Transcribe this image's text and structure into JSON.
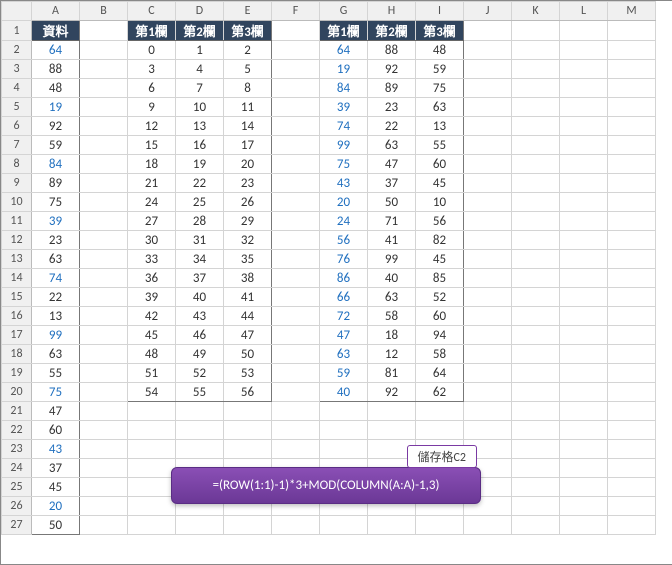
{
  "columns": [
    "A",
    "B",
    "C",
    "D",
    "E",
    "F",
    "G",
    "H",
    "I",
    "J",
    "K",
    "L",
    "M"
  ],
  "row_count": 27,
  "headers": {
    "A1": "資料",
    "C1": "第1欄",
    "D1": "第2欄",
    "E1": "第3欄",
    "G1": "第1欄",
    "H1": "第2欄",
    "I1": "第3欄"
  },
  "colA": {
    "values": [
      64,
      88,
      48,
      19,
      92,
      59,
      84,
      89,
      75,
      39,
      23,
      63,
      74,
      22,
      13,
      99,
      63,
      55,
      75,
      47,
      60,
      43,
      37,
      45,
      20,
      50
    ],
    "highlight": [
      true,
      false,
      false,
      true,
      false,
      false,
      true,
      false,
      false,
      true,
      false,
      false,
      true,
      false,
      false,
      true,
      false,
      false,
      true,
      false,
      false,
      true,
      false,
      false,
      true,
      false
    ]
  },
  "blockCDE": {
    "rows": 19,
    "data": [
      [
        0,
        1,
        2
      ],
      [
        3,
        4,
        5
      ],
      [
        6,
        7,
        8
      ],
      [
        9,
        10,
        11
      ],
      [
        12,
        13,
        14
      ],
      [
        15,
        16,
        17
      ],
      [
        18,
        19,
        20
      ],
      [
        21,
        22,
        23
      ],
      [
        24,
        25,
        26
      ],
      [
        27,
        28,
        29
      ],
      [
        30,
        31,
        32
      ],
      [
        33,
        34,
        35
      ],
      [
        36,
        37,
        38
      ],
      [
        39,
        40,
        41
      ],
      [
        42,
        43,
        44
      ],
      [
        45,
        46,
        47
      ],
      [
        48,
        49,
        50
      ],
      [
        51,
        52,
        53
      ],
      [
        54,
        55,
        56
      ]
    ]
  },
  "blockGHI": {
    "rows": 19,
    "data": [
      [
        64,
        88,
        48
      ],
      [
        19,
        92,
        59
      ],
      [
        84,
        89,
        75
      ],
      [
        39,
        23,
        63
      ],
      [
        74,
        22,
        13
      ],
      [
        99,
        63,
        55
      ],
      [
        75,
        47,
        60
      ],
      [
        43,
        37,
        45
      ],
      [
        20,
        50,
        10
      ],
      [
        24,
        71,
        56
      ],
      [
        56,
        41,
        82
      ],
      [
        76,
        99,
        45
      ],
      [
        86,
        40,
        85
      ],
      [
        66,
        63,
        52
      ],
      [
        72,
        58,
        60
      ],
      [
        47,
        18,
        94
      ],
      [
        63,
        12,
        58
      ],
      [
        59,
        81,
        64
      ],
      [
        40,
        92,
        62
      ]
    ]
  },
  "callout": {
    "tag": "儲存格C2",
    "formula": "=(ROW(1:1)-1)*3+MOD(COLUMN(A:A)-1,3)"
  }
}
